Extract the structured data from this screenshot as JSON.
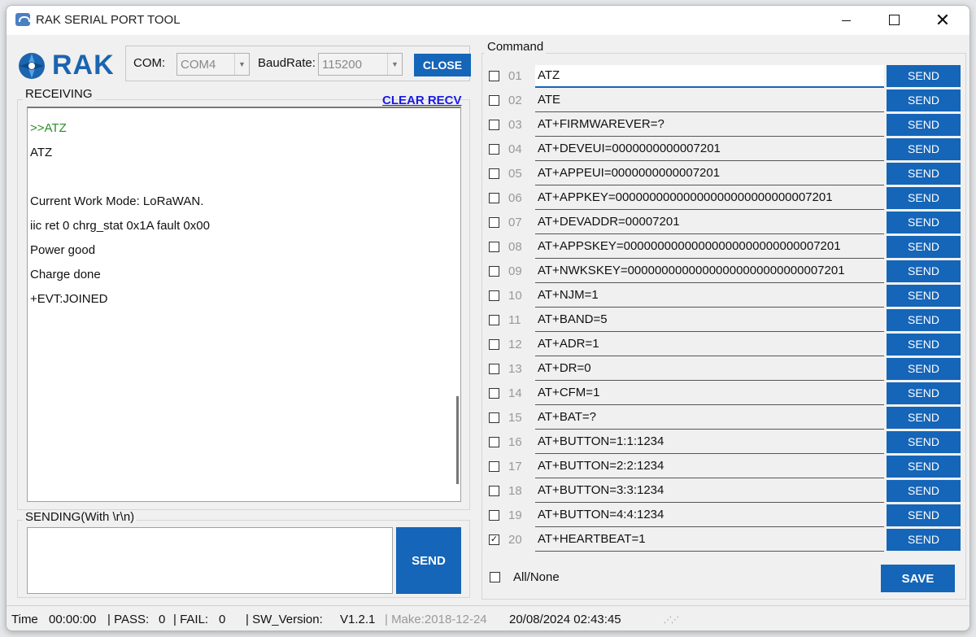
{
  "window": {
    "title": "RAK SERIAL PORT TOOL"
  },
  "logo": {
    "text": "RAK"
  },
  "connection": {
    "com_label": "COM:",
    "com_value": "COM4",
    "baud_label": "BaudRate:",
    "baud_value": "115200",
    "close_label": "CLOSE"
  },
  "receiving": {
    "label": "RECEIVING",
    "clear_label": "CLEAR RECV",
    "lines": [
      ">>ATZ",
      "ATZ",
      "",
      "Current Work Mode: LoRaWAN.",
      "iic ret 0 chrg_stat 0x1A fault 0x00",
      "Power good",
      "Charge done",
      "+EVT:JOINED"
    ]
  },
  "sending": {
    "label": "SENDING(With \\r\\n)",
    "value": "",
    "send_label": "SEND"
  },
  "command": {
    "label": "Command",
    "send_label": "SEND",
    "rows": [
      {
        "num": "01",
        "value": "ATZ",
        "checked": false
      },
      {
        "num": "02",
        "value": "ATE",
        "checked": false
      },
      {
        "num": "03",
        "value": "AT+FIRMWAREVER=?",
        "checked": false
      },
      {
        "num": "04",
        "value": "AT+DEVEUI=0000000000007201",
        "checked": false
      },
      {
        "num": "05",
        "value": "AT+APPEUI=0000000000007201",
        "checked": false
      },
      {
        "num": "06",
        "value": "AT+APPKEY=00000000000000000000000000007201",
        "checked": false
      },
      {
        "num": "07",
        "value": "AT+DEVADDR=00007201",
        "checked": false
      },
      {
        "num": "08",
        "value": "AT+APPSKEY=00000000000000000000000000007201",
        "checked": false
      },
      {
        "num": "09",
        "value": "AT+NWKSKEY=00000000000000000000000000007201",
        "checked": false
      },
      {
        "num": "10",
        "value": "AT+NJM=1",
        "checked": false
      },
      {
        "num": "11",
        "value": "AT+BAND=5",
        "checked": false
      },
      {
        "num": "12",
        "value": "AT+ADR=1",
        "checked": false
      },
      {
        "num": "13",
        "value": "AT+DR=0",
        "checked": false
      },
      {
        "num": "14",
        "value": "AT+CFM=1",
        "checked": false
      },
      {
        "num": "15",
        "value": "AT+BAT=?",
        "checked": false
      },
      {
        "num": "16",
        "value": "AT+BUTTON=1:1:1234",
        "checked": false
      },
      {
        "num": "17",
        "value": "AT+BUTTON=2:2:1234",
        "checked": false
      },
      {
        "num": "18",
        "value": "AT+BUTTON=3:3:1234",
        "checked": false
      },
      {
        "num": "19",
        "value": "AT+BUTTON=4:4:1234",
        "checked": false
      },
      {
        "num": "20",
        "value": "AT+HEARTBEAT=1",
        "checked": true
      }
    ],
    "all_none_label": "All/None",
    "save_label": "SAVE"
  },
  "status": {
    "time_label": "Time",
    "time_value": "00:00:00",
    "pass_label": "| PASS:",
    "pass_value": "0",
    "fail_label": "| FAIL:",
    "fail_value": "0",
    "sw_label": "| SW_Version:",
    "sw_value": "V1.2.1",
    "make": "| Make:2018-12-24",
    "datetime": "20/08/2024 02:43:45"
  },
  "colors": {
    "accent": "#1565b8",
    "echo_green": "#2c8c2c",
    "link_blue": "#1a1ae6"
  }
}
